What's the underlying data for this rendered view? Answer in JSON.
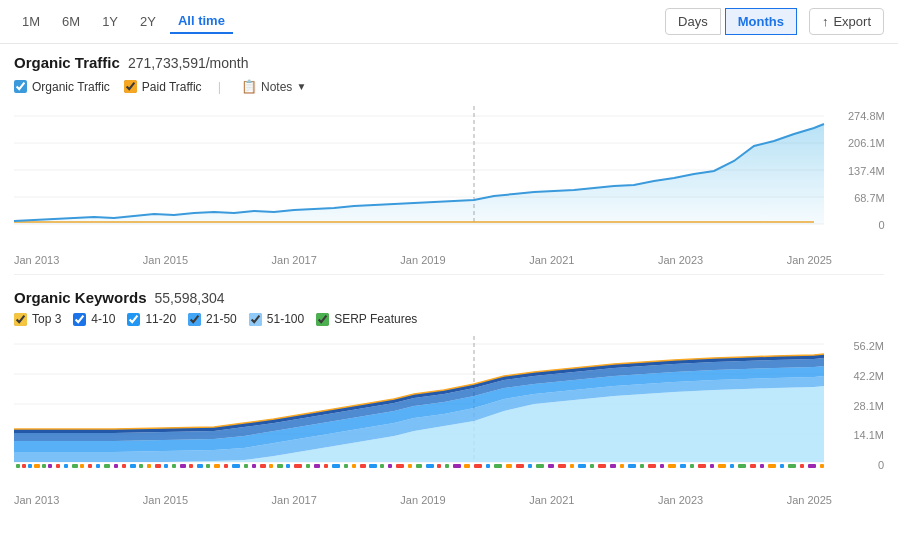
{
  "topBar": {
    "timeFilters": [
      "1M",
      "6M",
      "1Y",
      "2Y",
      "All time"
    ],
    "activeFilter": "All time",
    "viewButtons": [
      "Days",
      "Months"
    ],
    "activeView": "Months",
    "exportLabel": "Export"
  },
  "organicTraffic": {
    "title": "Organic Traffic",
    "value": "271,733,591/month",
    "legend": {
      "organicLabel": "Organic Traffic",
      "paidLabel": "Paid Traffic",
      "notesLabel": "Notes",
      "organicColor": "#3a9adb",
      "paidColor": "#f5a623"
    },
    "yAxis": [
      "274.8M",
      "206.1M",
      "137.4M",
      "68.7M",
      "0"
    ],
    "xAxis": [
      "Jan 2013",
      "Jan 2015",
      "Jan 2017",
      "Jan 2019",
      "Jan 2021",
      "Jan 2023",
      "Jan 2025"
    ]
  },
  "organicKeywords": {
    "title": "Organic Keywords",
    "value": "55,598,304",
    "legend": [
      {
        "label": "Top 3",
        "color": "#f5c542"
      },
      {
        "label": "4-10",
        "color": "#1a73e8"
      },
      {
        "label": "11-20",
        "color": "#2196f3"
      },
      {
        "label": "21-50",
        "color": "#42a5f5"
      },
      {
        "label": "51-100",
        "color": "#90caf9"
      },
      {
        "label": "SERP Features",
        "color": "#4caf50"
      }
    ],
    "yAxis": [
      "56.2M",
      "42.2M",
      "28.1M",
      "14.1M",
      "0"
    ],
    "xAxis": [
      "Jan 2013",
      "Jan 2015",
      "Jan 2017",
      "Jan 2019",
      "Jan 2021",
      "Jan 2023",
      "Jan 2025"
    ]
  }
}
